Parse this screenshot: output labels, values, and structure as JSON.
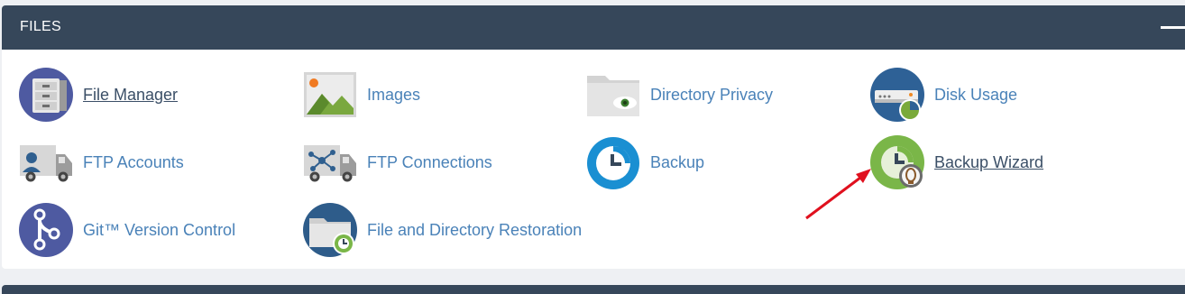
{
  "panel": {
    "title": "FILES"
  },
  "items": [
    {
      "label": "File Manager",
      "icon": "file-manager-icon"
    },
    {
      "label": "Images",
      "icon": "images-icon"
    },
    {
      "label": "Directory Privacy",
      "icon": "directory-privacy-icon"
    },
    {
      "label": "Disk Usage",
      "icon": "disk-usage-icon"
    },
    {
      "label": "FTP Accounts",
      "icon": "ftp-accounts-icon"
    },
    {
      "label": "FTP Connections",
      "icon": "ftp-connections-icon"
    },
    {
      "label": "Backup",
      "icon": "backup-icon"
    },
    {
      "label": "Backup Wizard",
      "icon": "backup-wizard-icon"
    },
    {
      "label": "Git™ Version Control",
      "icon": "git-icon"
    },
    {
      "label": "File and Directory Restoration",
      "icon": "restoration-icon"
    }
  ],
  "colors": {
    "header_bg": "#36475a",
    "link": "#4a82b8",
    "hover_link": "#3b4f67",
    "annotation_arrow": "#e0101e"
  }
}
